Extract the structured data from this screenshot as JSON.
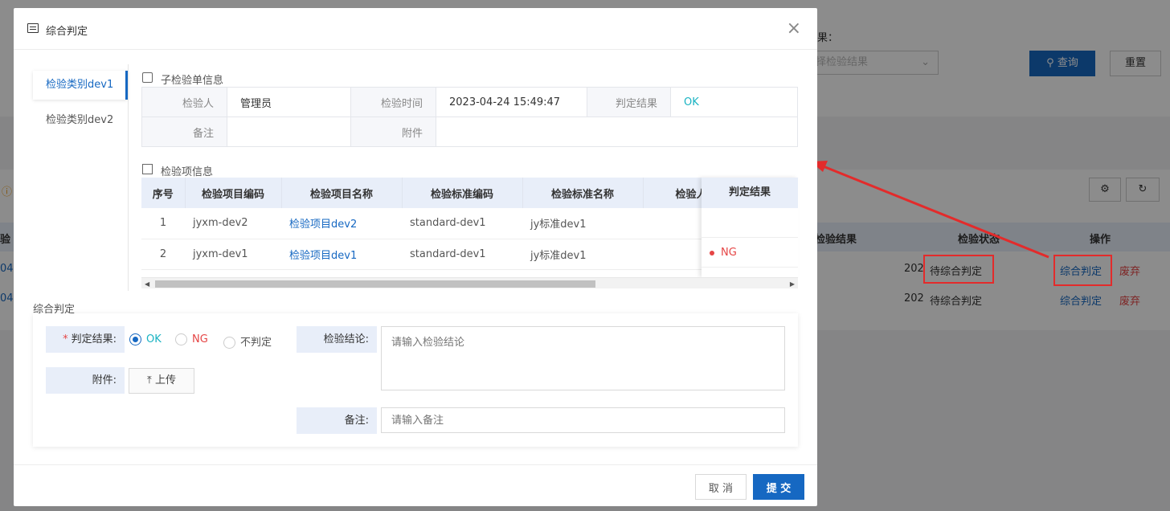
{
  "background": {
    "result_field_label": "果：",
    "result_select_placeholder": "择检验结果",
    "query_button": "查询",
    "reset_button": "重置",
    "table_headers": [
      "检验结果",
      "检验状态",
      "操作"
    ],
    "left_header_fragment": "验",
    "rows": [
      {
        "id_fragment": "04",
        "date_fragment": "202",
        "status": "待综合判定",
        "action": "综合判定",
        "discard": "废弃"
      },
      {
        "id_fragment": "04",
        "date_fragment": "202",
        "status": "待综合判定",
        "action": "综合判定",
        "discard": "废弃"
      }
    ]
  },
  "dialog": {
    "title": "综合判定",
    "close_icon": "×",
    "tabs": [
      "检验类别dev1",
      "检验类别dev2"
    ],
    "sub_info_title": "子检验单信息",
    "info": {
      "inspector_label": "检验人",
      "inspector_value": "管理员",
      "time_label": "检验时间",
      "time_value": "2023-04-24 15:49:47",
      "result_label": "判定结果",
      "result_value": "OK",
      "remark_label": "备注",
      "remark_value": "",
      "attachment_label": "附件",
      "attachment_value": ""
    },
    "items_title": "检验项信息",
    "items_headers": [
      "序号",
      "检验项目编码",
      "检验项目名称",
      "检验标准编码",
      "检验标准名称",
      "检验人"
    ],
    "items_result_header": "判定结果",
    "items": [
      {
        "no": "1",
        "code": "jyxm-dev2",
        "name": "检验项目dev2",
        "std_code": "standard-dev1",
        "std_name": "jy标准dev1",
        "result": ""
      },
      {
        "no": "2",
        "code": "jyxm-dev1",
        "name": "检验项目dev1",
        "std_code": "standard-dev1",
        "std_name": "jy标准dev1",
        "result": "NG"
      }
    ],
    "judge": {
      "section_title": "综合判定",
      "result_label": "判定结果:",
      "required_mark": "*",
      "options": [
        "OK",
        "NG",
        "不判定"
      ],
      "selected": "OK",
      "attachment_label": "附件:",
      "upload_label": "上传",
      "conclusion_label": "检验结论:",
      "conclusion_placeholder": "请输入检验结论",
      "remark_label": "备注:",
      "remark_placeholder": "请输入备注"
    },
    "cancel_label": "取 消",
    "submit_label": "提 交"
  },
  "colors": {
    "primary": "#1668c2",
    "ok": "#19b3c2",
    "ng": "#e54545",
    "annotation": "#e32b2b"
  }
}
